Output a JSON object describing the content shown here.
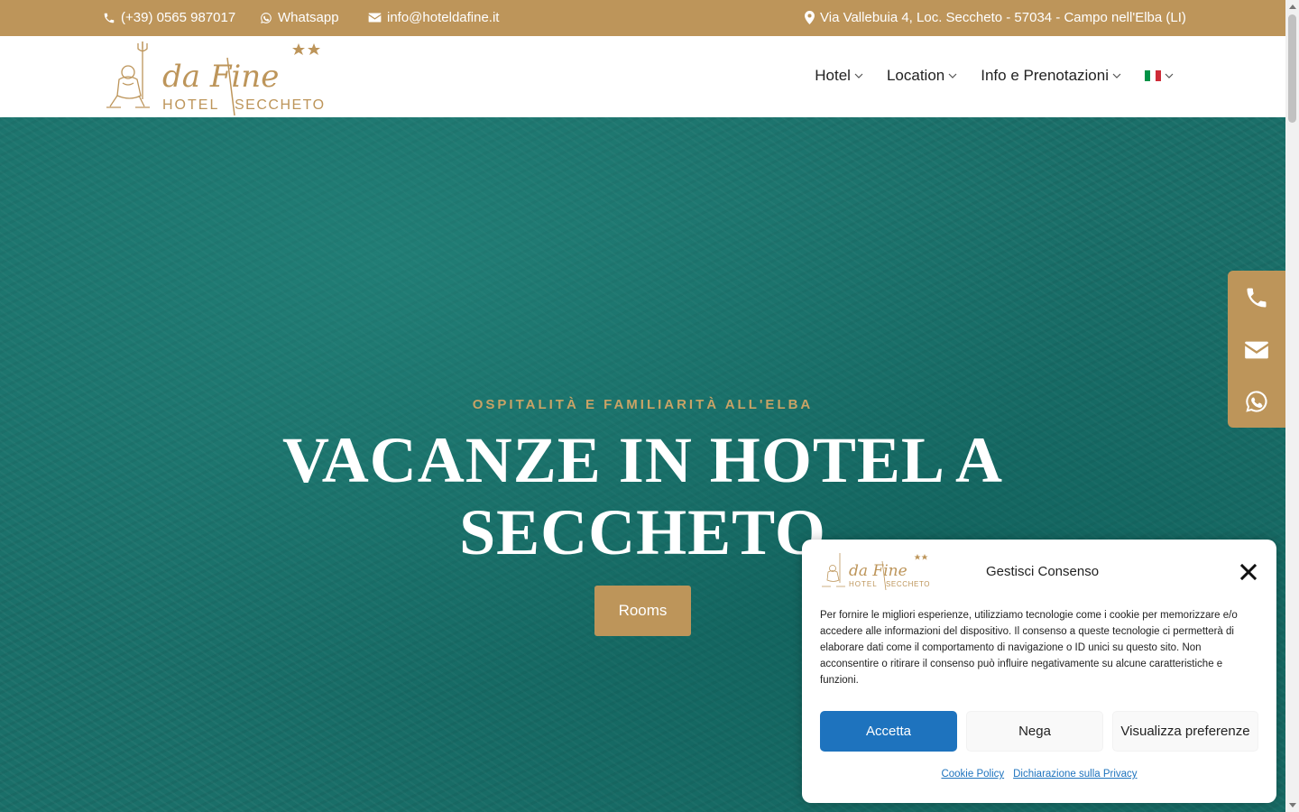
{
  "topbar": {
    "phone": "(+39) 0565 987017",
    "whatsapp": "Whatsapp",
    "email": "info@hoteldafine.it",
    "address": "Via Vallebuia 4, Loc. Seccheto - 57034 - Campo nell'Elba (LI)"
  },
  "logo": {
    "script": "da Fine",
    "hotel": "HOTEL",
    "place": "SECCHETO"
  },
  "nav": {
    "items": [
      "Hotel",
      "Location",
      "Info e Prenotazioni"
    ],
    "language": "it"
  },
  "hero": {
    "eyebrow": "OSPITALITÀ E FAMILIARITÀ ALL'ELBA",
    "title_line1": "VACANZE IN HOTEL A",
    "title_line2": "SECCHETO",
    "button": "Rooms"
  },
  "side_contacts": [
    "phone-icon",
    "envelope-icon",
    "whatsapp-icon"
  ],
  "consent": {
    "title": "Gestisci Consenso",
    "text": "Per fornire le migliori esperienze, utilizziamo tecnologie come i cookie per memorizzare e/o accedere alle informazioni del dispositivo. Il consenso a queste tecnologie ci permetterà di elaborare dati come il comportamento di navigazione o ID unici su questo sito. Non acconsentire o ritirare il consenso può influire negativamente su alcune caratteristiche e funzioni.",
    "accept": "Accetta",
    "deny": "Nega",
    "preferences": "Visualizza preferenze",
    "cookie_policy": "Cookie Policy",
    "privacy": "Dichiarazione sulla Privacy"
  },
  "colors": {
    "brand_gold": "#bd955a",
    "accept_blue": "#1e73be",
    "sea": "#1a6f69"
  }
}
